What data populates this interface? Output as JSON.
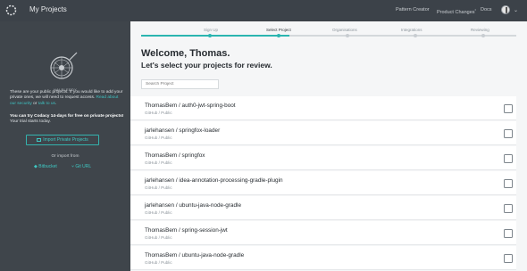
{
  "app": {
    "title": "My Projects"
  },
  "topnav": {
    "pattern_creator": "Pattern Creator",
    "product_changes": "Product Changes",
    "product_changes_marker": "•",
    "docs": "Docs"
  },
  "sidebar": {
    "caption": "HALBLEEDY",
    "paragraph1_before": "These are your public projects. If you would like to add your private ones, we will need to request access. ",
    "paragraph1_link1": "Read about our security",
    "paragraph1_or": " or ",
    "paragraph1_link2": "talk to us",
    "paragraph1_end": ".",
    "paragraph2_bold": "You can try Codacy 14-days for free on private projects!",
    "paragraph2_rest": " Your trial starts today.",
    "import_button": "Import Private Projects",
    "or_import_from": "Or import from",
    "bitbucket": "Bitbucket",
    "git_url": "Git URL"
  },
  "steps": [
    {
      "label": "Sign Up",
      "state": "done"
    },
    {
      "label": "Select Project",
      "state": "active"
    },
    {
      "label": "Organisations",
      "state": "todo"
    },
    {
      "label": "Integrations",
      "state": "todo"
    },
    {
      "label": "Reviewing",
      "state": "todo"
    }
  ],
  "main": {
    "welcome": "Welcome, Thomas.",
    "subhead": "Let's select your projects for review.",
    "search_placeholder": "Search Project"
  },
  "projects": [
    {
      "name": "ThomasBem / auth0-jwt-spring-boot",
      "meta": "GitHub / Public",
      "selected": false
    },
    {
      "name": "jarlehansen / springfox-loader",
      "meta": "GitHub / Public",
      "selected": false
    },
    {
      "name": "ThomasBem / springfox",
      "meta": "GitHub / Public",
      "selected": false
    },
    {
      "name": "jarlehansen / idea-annotation-processing-gradle-plugin",
      "meta": "GitHub / Public",
      "selected": false
    },
    {
      "name": "jarlehansen / ubuntu-java-node-gradle",
      "meta": "GitHub / Public",
      "selected": false
    },
    {
      "name": "ThomasBem / spring-session-jwt",
      "meta": "GitHub / Public",
      "selected": false
    },
    {
      "name": "ThomasBem / ubuntu-java-node-gradle",
      "meta": "GitHub / Public",
      "selected": false
    }
  ],
  "colors": {
    "topbar": "#3c4249",
    "sidebar": "#3f454b",
    "accent": "#2bb5b0"
  }
}
